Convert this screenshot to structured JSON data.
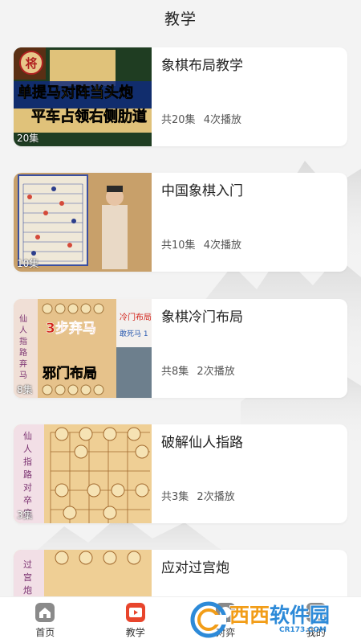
{
  "header": {
    "title": "教学"
  },
  "courses": [
    {
      "title": "象棋布局教学",
      "episodes_badge": "20集",
      "episodes": "共20集",
      "plays": "4次播放",
      "thumb_text": [
        "单提马对阵当头炮",
        "平车占领右侧肋道"
      ],
      "thumb_badge": "将"
    },
    {
      "title": "中国象棋入门",
      "episodes_badge": "10集",
      "episodes": "共10集",
      "plays": "4次播放"
    },
    {
      "title": "象棋冷门布局",
      "episodes_badge": "8集",
      "episodes": "共8集",
      "plays": "2次播放",
      "thumb_text": [
        "仙人指路弃马",
        "3步弃马",
        "邪门布局",
        "冷门布局",
        "敢死马 1"
      ]
    },
    {
      "title": "破解仙人指路",
      "episodes_badge": "3集",
      "episodes": "共3集",
      "plays": "2次播放",
      "thumb_text": [
        "仙人指路对卒底炮"
      ]
    },
    {
      "title": "应对过宫炮",
      "episodes_badge": "",
      "episodes": "",
      "plays": "",
      "thumb_text": [
        "过宫炮"
      ]
    }
  ],
  "tabbar": {
    "items": [
      {
        "label": "首页",
        "icon": "home-icon"
      },
      {
        "label": "教学",
        "icon": "play-video-icon",
        "active": true
      },
      {
        "label": "对弈",
        "icon": "chess-icon"
      },
      {
        "label": "我的",
        "icon": "user-icon"
      }
    ]
  },
  "watermark": {
    "main": "西西",
    "sub": "软件园",
    "url": "CR173.COM"
  },
  "colors": {
    "accent": "#e8452c",
    "watermark_orange": "#f29d18",
    "watermark_blue": "#2d8ad8"
  }
}
